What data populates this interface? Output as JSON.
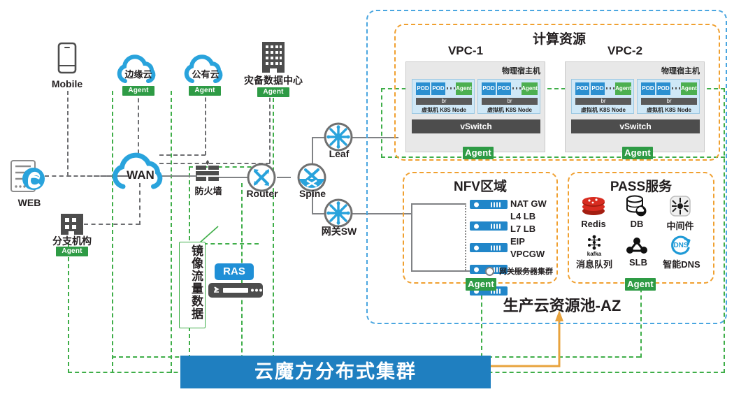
{
  "left_zone": {
    "nodes": [
      {
        "name": "mobile",
        "label": "Mobile",
        "icon": "mobile-phone-icon"
      },
      {
        "name": "web",
        "label": "WEB",
        "icon": "web-server-ie-icon"
      },
      {
        "name": "branch",
        "label": "分支机构",
        "icon": "office-building-icon",
        "agent": "Agent"
      },
      {
        "name": "edge-cloud",
        "label": "边缘云",
        "icon": "cloud-icon",
        "agent": "Agent"
      },
      {
        "name": "public-cloud",
        "label": "公有云",
        "icon": "cloud-icon",
        "agent": "Agent"
      },
      {
        "name": "dr-datacenter",
        "label": "灾备数据中心",
        "icon": "datacenter-building-icon",
        "agent": "Agent"
      },
      {
        "name": "wan",
        "label": "WAN",
        "icon": "cloud-icon"
      },
      {
        "name": "firewall",
        "label": "防火墙",
        "icon": "firewall-icon"
      },
      {
        "name": "router",
        "label": "Router",
        "icon": "router-icon"
      },
      {
        "name": "spine",
        "label": "Spine",
        "icon": "switch-icon"
      },
      {
        "name": "leaf",
        "label": "Leaf",
        "icon": "switch-snowflake-icon"
      },
      {
        "name": "gateway-sw",
        "label": "网关SW",
        "icon": "switch-snowflake-icon"
      }
    ],
    "mirror_box": {
      "label": "镜像流量数据"
    },
    "ras": {
      "label": "RAS",
      "icon": "ras-appliance-icon"
    }
  },
  "cloud_pool": {
    "title": "生产云资源池-AZ",
    "compute": {
      "title": "计算资源",
      "agent_badges": [
        "Agent",
        "Agent"
      ],
      "vpcs": [
        {
          "name": "VPC-1",
          "host_label": "物理宿主机",
          "vswitch": "vSwitch",
          "nodes": [
            {
              "pods": [
                "POD",
                "POD"
              ],
              "agent": "Agent",
              "bridge": "br",
              "label": "虚拟机 K8S Node"
            },
            {
              "pods": [
                "POD",
                "POD"
              ],
              "agent": "Agent",
              "bridge": "br",
              "label": "虚拟机 K8S Node"
            }
          ]
        },
        {
          "name": "VPC-2",
          "host_label": "物理宿主机",
          "vswitch": "vSwitch",
          "nodes": [
            {
              "pods": [
                "POD",
                "POD"
              ],
              "agent": "Agent",
              "bridge": "br",
              "label": "虚拟机 K8S Node"
            },
            {
              "pods": [
                "POD",
                "POD"
              ],
              "agent": "Agent",
              "bridge": "br",
              "label": "虚拟机 K8S Node"
            }
          ]
        }
      ]
    },
    "nfv": {
      "title": "NFV区域",
      "agent": "Agent",
      "cluster_label": "网关服务器集群",
      "items": [
        "NAT GW",
        "L4 LB",
        "L7 LB",
        "EIP",
        "VPCGW"
      ]
    },
    "pass": {
      "title": "PASS服务",
      "agent": "Agent",
      "items": [
        {
          "label": "Redis",
          "icon": "redis-icon"
        },
        {
          "label": "DB",
          "icon": "database-cloud-icon"
        },
        {
          "label": "中间件",
          "icon": "middleware-icon"
        },
        {
          "label": "消息队列",
          "icon": "kafka-icon",
          "sublabel": "kafka"
        },
        {
          "label": "SLB",
          "icon": "slb-nodes-icon"
        },
        {
          "label": "智能DNS",
          "icon": "dns-icon"
        }
      ]
    }
  },
  "bottom_bar": {
    "label": "云魔方分布式集群"
  },
  "colors": {
    "agent_green": "#2e9b45",
    "brand_blue": "#1f7fc0",
    "cloud_blue": "#29a3dc",
    "orange": "#f0a030",
    "arrow_orange": "#e8a33d"
  }
}
